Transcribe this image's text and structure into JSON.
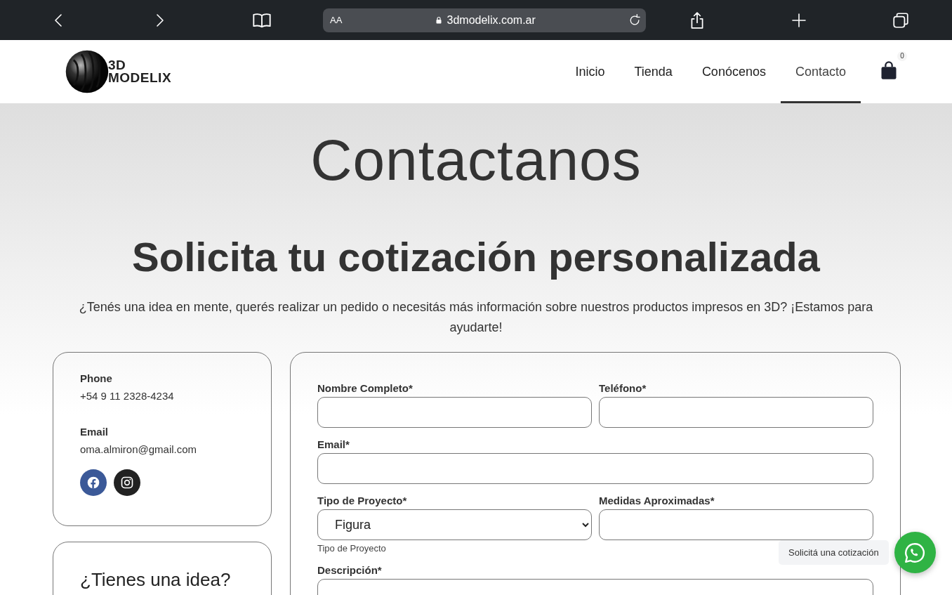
{
  "browser": {
    "text_size": "AA",
    "url": "3dmodelix.com.ar"
  },
  "header": {
    "logo": [
      "3D",
      "MODELIX"
    ],
    "nav": [
      {
        "label": "Inicio",
        "selected": false
      },
      {
        "label": "Tienda",
        "selected": false
      },
      {
        "label": "Conócenos",
        "selected": false
      },
      {
        "label": "Contacto",
        "selected": true
      }
    ],
    "cart": {
      "count": "0"
    }
  },
  "hero": {
    "title": "Contactanos",
    "subtitle": "Solicita tu cotización personalizada",
    "intro": "¿Tenés una idea en mente, querés realizar un pedido o necesitás más información sobre nuestros productos impresos en 3D? ¡Estamos para ayudarte!"
  },
  "contact_card": {
    "items": [
      {
        "label": "Phone",
        "value": "+54 9 11 2328-4234"
      },
      {
        "label": "Email",
        "value": "oma.almiron@gmail.com"
      }
    ],
    "social": [
      {
        "kind": "facebook"
      },
      {
        "kind": "instagram"
      }
    ]
  },
  "idea_card": {
    "title": "¿Tienes una idea?"
  },
  "form": {
    "rows": [
      [
        {
          "kind": "text",
          "label": "Nombre Completo*"
        },
        {
          "kind": "text",
          "label": "Teléfono*"
        }
      ],
      [
        {
          "kind": "text",
          "label": "Email*"
        }
      ],
      [
        {
          "kind": "select",
          "label": "Tipo de Proyecto*",
          "value": "Figura",
          "helper": "Tipo de Proyecto"
        },
        {
          "kind": "text",
          "label": "Medidas Aproximadas*"
        }
      ],
      [
        {
          "kind": "textarea",
          "label": "Descripción*"
        }
      ]
    ]
  },
  "chat": {
    "label": "Solicitá una cotización"
  }
}
